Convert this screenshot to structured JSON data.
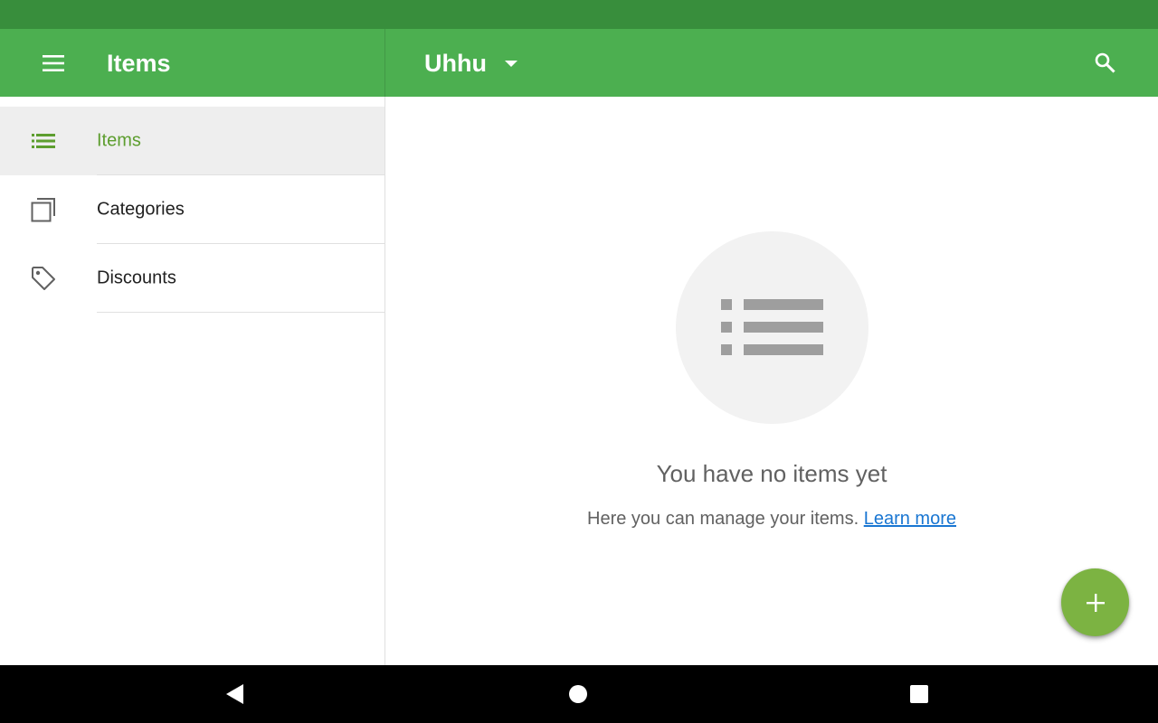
{
  "app_bar": {
    "title": "Items",
    "location": "Uhhu",
    "color": "#4caf50",
    "status_bar_color": "#388e3c"
  },
  "sidebar": {
    "items": [
      {
        "label": "Items",
        "icon": "list-icon",
        "active": true
      },
      {
        "label": "Categories",
        "icon": "categories-icon",
        "active": false
      },
      {
        "label": "Discounts",
        "icon": "tag-icon",
        "active": false
      }
    ]
  },
  "main": {
    "empty_icon": "list-icon",
    "empty_title": "You have no items yet",
    "empty_subtitle": "Here you can manage your items.",
    "learn_more": "Learn more"
  },
  "fab": {
    "icon": "plus-icon",
    "color": "#7cb342"
  },
  "system_nav": {
    "back_icon": "back-icon",
    "home_icon": "home-icon",
    "recents_icon": "recents-icon"
  }
}
